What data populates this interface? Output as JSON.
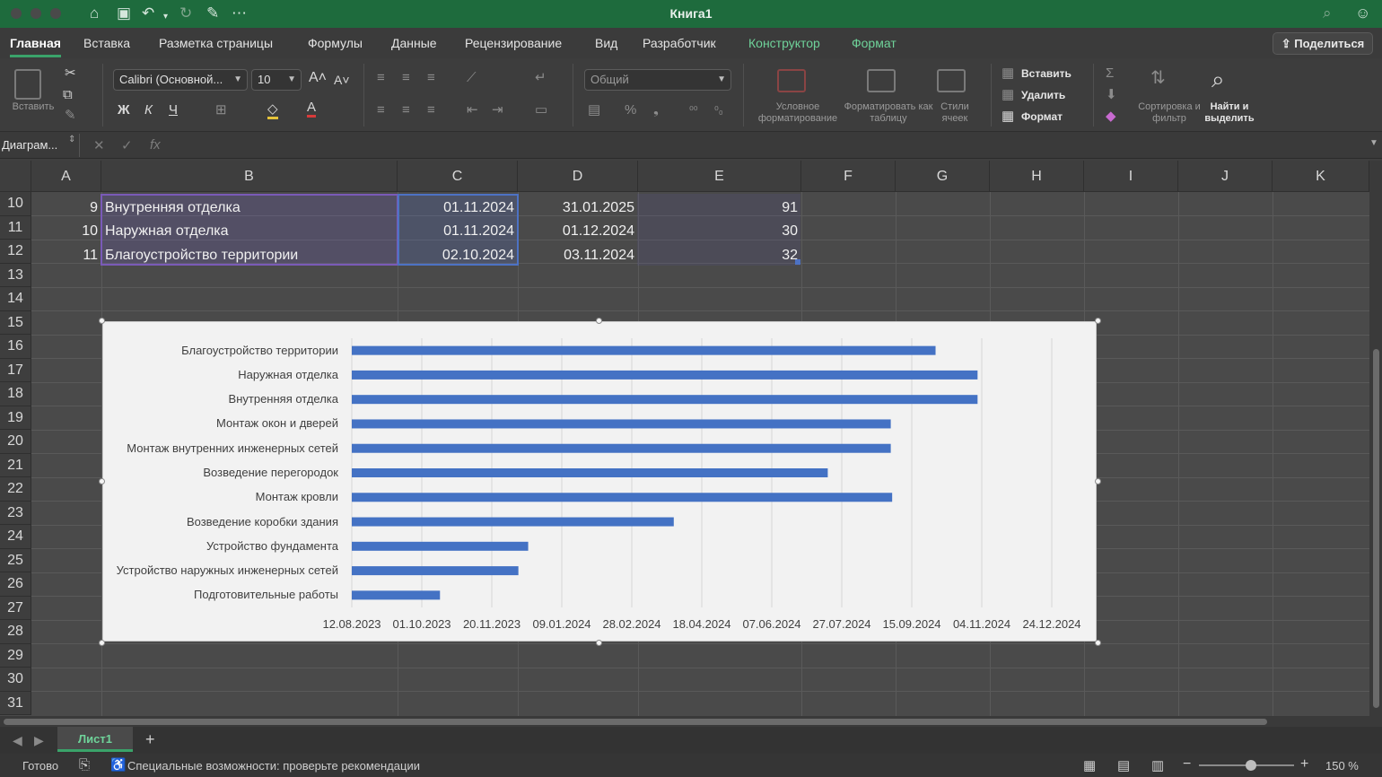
{
  "window": {
    "title": "Книга1"
  },
  "ribbon_tabs": [
    "Главная",
    "Вставка",
    "Разметка страницы",
    "Формулы",
    "Данные",
    "Рецензирование",
    "Вид",
    "Разработчик",
    "Конструктор",
    "Формат"
  ],
  "share_label": "Поделиться",
  "ribbon": {
    "paste_label": "Вставить",
    "font_name": "Calibri (Основной...",
    "font_size": "10",
    "bold": "Ж",
    "italic": "К",
    "underline": "Ч",
    "number_format": "Общий",
    "percent": "%",
    "cond_format_label": "Условное форматирование",
    "format_table_label": "Форматировать как таблицу",
    "cell_styles_label": "Стили ячеек",
    "insert_label": "Вставить",
    "delete_label": "Удалить",
    "format_label": "Формат",
    "sort_label": "Сортировка и фильтр",
    "find_label": "Найти и выделить"
  },
  "formula_bar": {
    "name_box": "Диаграм...",
    "fx": "fx"
  },
  "columns": [
    "A",
    "B",
    "C",
    "D",
    "E",
    "F",
    "G",
    "H",
    "I",
    "J",
    "K"
  ],
  "rows": [
    "10",
    "11",
    "12",
    "13",
    "14",
    "15",
    "16",
    "17",
    "18",
    "19",
    "20",
    "21",
    "22",
    "23",
    "24",
    "25",
    "26",
    "27",
    "28",
    "29",
    "30",
    "31"
  ],
  "table_rows": [
    {
      "a": "9",
      "b": "Внутренняя отделка",
      "c": "01.11.2024",
      "d": "31.01.2025",
      "e": "91"
    },
    {
      "a": "10",
      "b": "Наружная отделка",
      "c": "01.11.2024",
      "d": "01.12.2024",
      "e": "30"
    },
    {
      "a": "11",
      "b": "Благоустройство территории",
      "c": "02.10.2024",
      "d": "03.11.2024",
      "e": "32"
    }
  ],
  "chart_data": {
    "type": "bar",
    "orientation": "horizontal",
    "categories": [
      "Благоустройство территории",
      "Наружная отделка",
      "Внутренняя отделка",
      "Монтаж окон и дверей",
      "Монтаж внутренних инженерных сетей",
      "Возведение перегородок",
      "Монтаж кровли",
      "Возведение коробки здания",
      "Устройство фундамента",
      "Устройство наружных инженерных сетей",
      "Подготовительные работы"
    ],
    "values": [
      "2024-10-02",
      "2024-11-01",
      "2024-11-01",
      "2024-08-31",
      "2024-08-31",
      "2024-07-17",
      "2024-09-01",
      "2024-03-29",
      "2023-12-16",
      "2023-12-09",
      "2023-10-14"
    ],
    "x_ticks": [
      "12.08.2023",
      "01.10.2023",
      "20.11.2023",
      "09.01.2024",
      "28.02.2024",
      "18.04.2024",
      "07.06.2024",
      "27.07.2024",
      "15.09.2024",
      "04.11.2024",
      "24.12.2024"
    ],
    "xlim": [
      "2023-08-12",
      "2024-12-24"
    ],
    "bar_color": "#4472c4",
    "grid": true
  },
  "sheet_tab": "Лист1",
  "add_sheet": "+",
  "status": {
    "ready": "Готово",
    "accessibility": "Специальные возможности: проверьте рекомендации",
    "zoom": "150 %"
  }
}
